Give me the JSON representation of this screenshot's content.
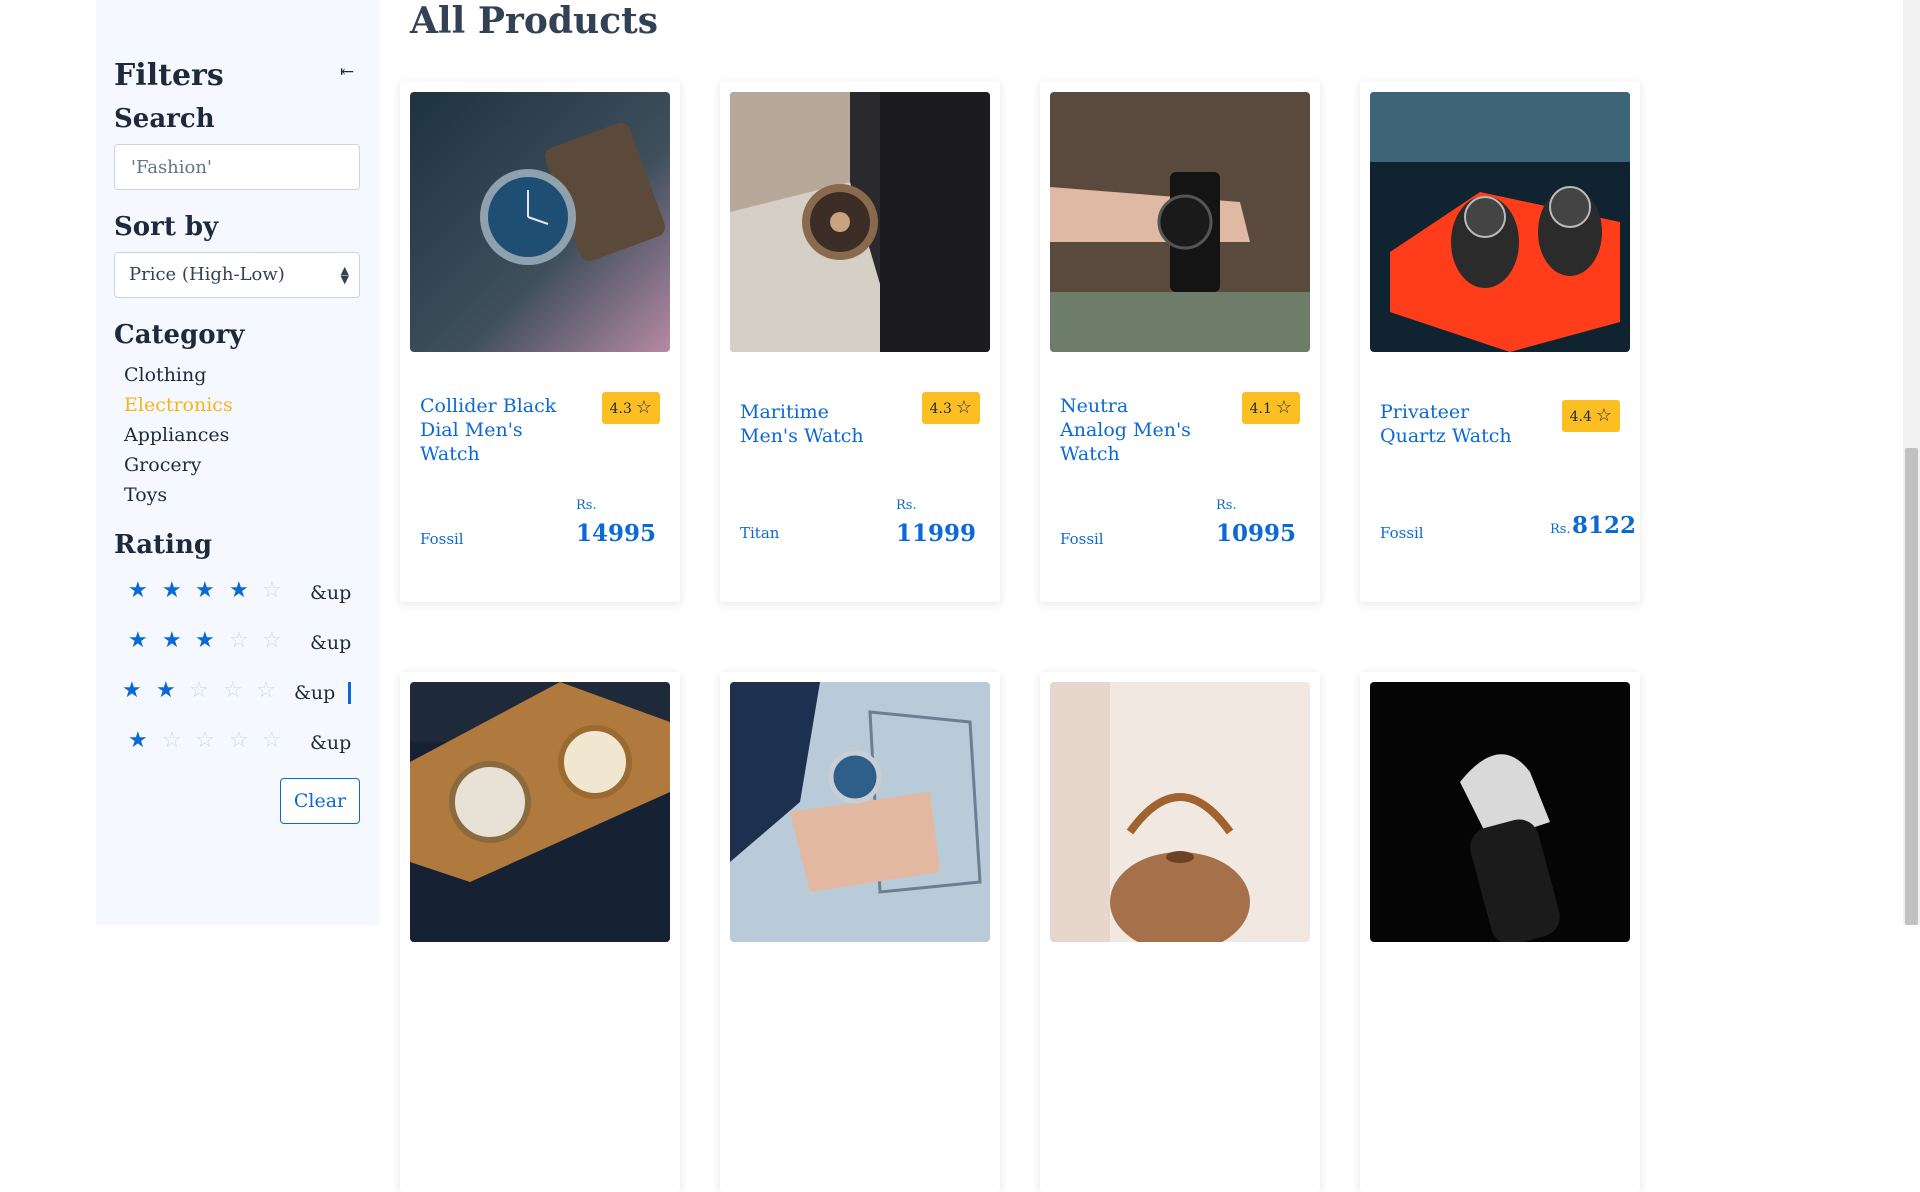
{
  "page": {
    "title": "All Products"
  },
  "filters": {
    "title": "Filters",
    "collapse_icon": "collapse-left-arrow-icon",
    "search": {
      "label": "Search",
      "placeholder": "'Fashion'"
    },
    "sort": {
      "label": "Sort by",
      "selected": "Price (High-Low)",
      "icon": "sort-arrows-icon"
    },
    "category": {
      "label": "Category",
      "items": [
        {
          "label": "Clothing",
          "active": false
        },
        {
          "label": "Electronics",
          "active": true
        },
        {
          "label": "Appliances",
          "active": false
        },
        {
          "label": "Grocery",
          "active": false
        },
        {
          "label": "Toys",
          "active": false
        }
      ]
    },
    "rating": {
      "label": "Rating",
      "options": [
        {
          "stars": 4,
          "label": "&up",
          "selected": false
        },
        {
          "stars": 3,
          "label": "&up",
          "selected": false
        },
        {
          "stars": 2,
          "label": "&up",
          "selected": true
        },
        {
          "stars": 1,
          "label": "&up",
          "selected": false
        }
      ]
    },
    "clear_label": "Clear"
  },
  "products": [
    {
      "name": "Collider Black Dial Men's Watch",
      "rating": "4.3",
      "brand": "Fossil",
      "currency": "Rs.",
      "price": "14995"
    },
    {
      "name": "Maritime Men's Watch",
      "rating": "4.3",
      "brand": "Titan",
      "currency": "Rs.",
      "price": "11999"
    },
    {
      "name": "Neutra Analog Men's Watch",
      "rating": "4.1",
      "brand": "Fossil",
      "currency": "Rs.",
      "price": "10995"
    },
    {
      "name": "Privateer Quartz Watch",
      "rating": "4.4",
      "brand": "Fossil",
      "currency": "Rs.",
      "price": "8122"
    }
  ],
  "colors": {
    "accent": "#0b69d6",
    "active_category": "#f5b51a",
    "rating_badge": "#fbbf24",
    "sidebar_bg": "#f5f9ff"
  }
}
